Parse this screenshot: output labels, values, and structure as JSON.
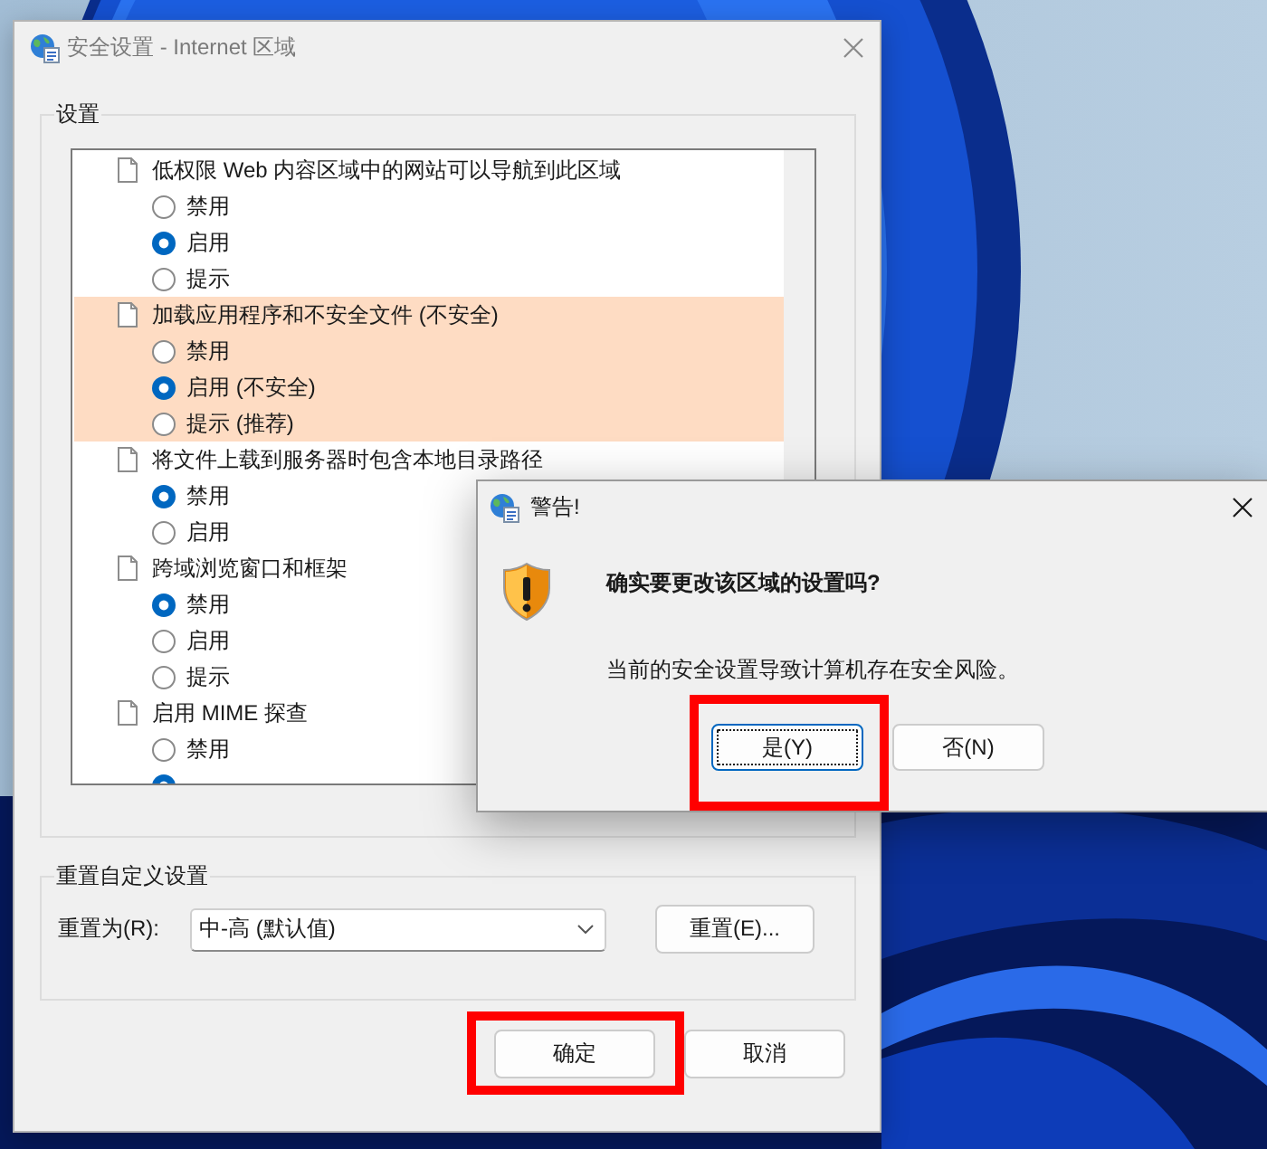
{
  "security_dialog": {
    "title": "安全设置 - Internet 区域",
    "active": false,
    "settings_group": {
      "label": "设置",
      "settings": [
        {
          "label": "低权限 Web 内容区域中的网站可以导航到此区域",
          "highlighted": false,
          "options": [
            {
              "label": "禁用",
              "selected": false
            },
            {
              "label": "启用",
              "selected": true
            },
            {
              "label": "提示",
              "selected": false
            }
          ]
        },
        {
          "label": "加载应用程序和不安全文件 (不安全)",
          "highlighted": true,
          "options": [
            {
              "label": "禁用",
              "selected": false
            },
            {
              "label": "启用 (不安全)",
              "selected": true
            },
            {
              "label": "提示 (推荐)",
              "selected": false
            }
          ]
        },
        {
          "label": "将文件上载到服务器时包含本地目录路径",
          "highlighted": false,
          "options": [
            {
              "label": "禁用",
              "selected": true
            },
            {
              "label": "启用",
              "selected": false
            }
          ]
        },
        {
          "label": "跨域浏览窗口和框架",
          "highlighted": false,
          "options": [
            {
              "label": "禁用",
              "selected": true
            },
            {
              "label": "启用",
              "selected": false
            },
            {
              "label": "提示",
              "selected": false
            }
          ]
        },
        {
          "label": "启用 MIME 探查",
          "highlighted": false,
          "options": [
            {
              "label": "禁用",
              "selected": false
            },
            {
              "selected": true
            }
          ]
        }
      ]
    },
    "reset_group": {
      "label": "重置自定义设置",
      "field_label": "重置为(R):",
      "dropdown": {
        "value": "中-高 (默认值)"
      },
      "reset_button": "重置(E)..."
    },
    "buttons": [
      {
        "label": "确定",
        "annotated": true
      },
      {
        "label": "取消",
        "annotated": false
      }
    ]
  },
  "warning_dialog": {
    "title": "警告!",
    "active": true,
    "heading": "确实要更改该区域的设置吗?",
    "message": "当前的安全设置导致计算机存在安全风险。",
    "buttons": [
      {
        "label": "是(Y)",
        "focused": true,
        "annotated": true
      },
      {
        "label": "否(N)",
        "focused": false,
        "annotated": false
      }
    ]
  }
}
